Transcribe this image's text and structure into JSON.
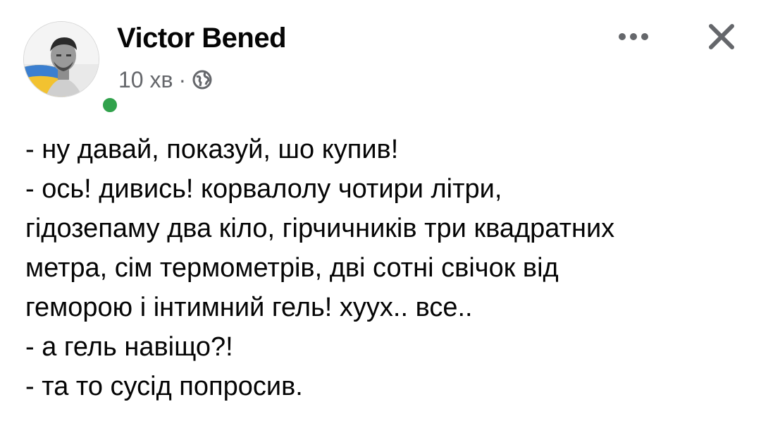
{
  "post": {
    "author": "Victor Bened",
    "time": "10 хв",
    "separator": "·",
    "privacy_icon": "globe-icon",
    "online": true,
    "lines": [
      "- ну давай, показуй, шо купив!",
      "- ось! дивись! корвалолу чотири літри,",
      "гідозепаму два кіло, гірчичників три квадратних",
      "метра, сім термометрів, дві сотні свічок від",
      "геморою і інтимний гель! хуух.. все..",
      "- а гель навіщо?!",
      "- та то сусід попросив."
    ]
  },
  "toolbar": {
    "more_icon": "more-horizontal-icon",
    "close_icon": "close-icon"
  },
  "colors": {
    "online": "#31a24c",
    "meta_text": "#65676b",
    "text": "#050505",
    "icon": "#65676b"
  }
}
